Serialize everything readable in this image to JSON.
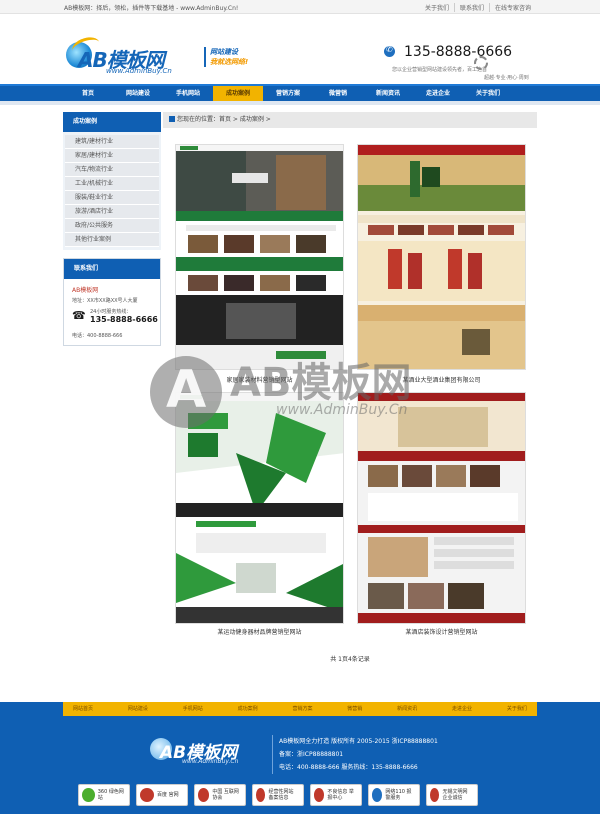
{
  "topbar": {
    "welcome": "AB模板网：择后，领松，插件等下载基地 - www.AdminBuy.Cn!",
    "links": [
      "关于我们",
      "联系我们",
      "在线专家咨询"
    ]
  },
  "header": {
    "logo_name": "AB模板网",
    "logo_url": "www.AdminBuy.Cn",
    "slogan_line1": "网站建设",
    "slogan_line2": "我就选网络!",
    "phone": "135-8888-6666",
    "sub1": "您以企业营销型网站建设领先者，百工之首",
    "sub2": "超越·专业·用心·周到"
  },
  "nav": {
    "items": [
      "首页",
      "网站建设",
      "手机网站",
      "成功案例",
      "营销方案",
      "微营销",
      "新闻资讯",
      "走进企业",
      "关于我们"
    ],
    "active_index": 3
  },
  "sidebar": {
    "cases_title": "成功案例",
    "categories": [
      "建筑/建材行业",
      "家居/建材行业",
      "汽车/物流行业",
      "工业/机械行业",
      "服装/鞋业行业",
      "旅游/酒店行业",
      "政府/公共服务",
      "其他行业案例"
    ],
    "contact_title": "联系我们",
    "company": "AB模板网",
    "address": "地址：XX市XX路XX号人大厦",
    "hotline_label": "24小时服务热线：",
    "hotline": "135-8888-6666",
    "tel": "电话：400-8888-666"
  },
  "breadcrumb": "您现在的位置：首页 > 成功案例 >",
  "cases": [
    {
      "title": "家居家装材料营销型网站"
    },
    {
      "title": "某酒业大型酒业集团有限公司"
    },
    {
      "title": "某运动健身器材品牌营销型网站"
    },
    {
      "title": "某酒店装饰设计营销型网站"
    }
  ],
  "pager": "共 1页4条记录",
  "footer": {
    "nav": [
      "网站首页",
      "网站建设",
      "手机网站",
      "成功案例",
      "营销方案",
      "微营销",
      "新闻资讯",
      "走进企业",
      "关于我们"
    ],
    "logo_name": "AB模板网",
    "logo_url": "www.AdminBuy.Cn",
    "copyright": "AB模板网全力打造 版权所有 2005-2015 浙ICP88888801",
    "record": "备案：浙ICP88888801",
    "contact": "电话：400-8888-666 服务热线：135-8888-6666",
    "badges": [
      {
        "label": "360 绿色网站",
        "color": "#4cae2e"
      },
      {
        "label": "百度 官网",
        "color": "#c0392b"
      },
      {
        "label": "中国 互联网协会",
        "color": "#c0392b"
      },
      {
        "label": "经营性网站 备案信息",
        "color": "#c0392b"
      },
      {
        "label": "不良信息 举报中心",
        "color": "#c0392b"
      },
      {
        "label": "网络110 报警服务",
        "color": "#1f6fbf"
      },
      {
        "label": "无锡文明网 企业诚信",
        "color": "#c0392b"
      }
    ]
  },
  "watermark": {
    "text": "AB模板网",
    "url": "www.AdminBuy.Cn"
  }
}
